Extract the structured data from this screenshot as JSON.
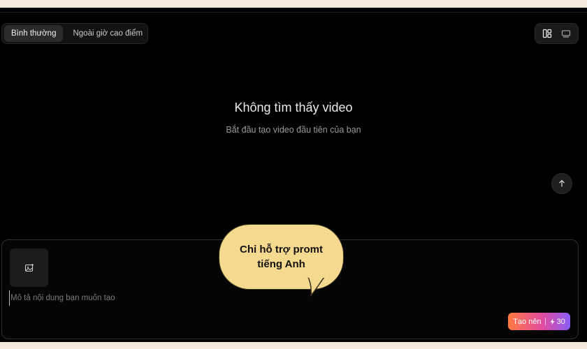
{
  "modes": {
    "normal": "Bình thường",
    "offpeak": "Ngoài giờ cao điểm"
  },
  "empty_state": {
    "title": "Không tìm thấy video",
    "subtitle": "Bắt đầu tạo video đầu tiên của bạn"
  },
  "composer": {
    "placeholder": "Mô tả nội dung bạn muốn tạo",
    "generate_label": "Tạo nên",
    "credits": "30"
  },
  "callout": {
    "text": "Chỉ hỗ trợ promt tiếng Anh"
  },
  "icons": {
    "layout": "grid-layout-icon",
    "list": "list-view-icon",
    "scroll_top": "arrow-up-icon",
    "upload": "image-upload-icon",
    "credits": "lightning-icon"
  },
  "colors": {
    "background": "#000000",
    "callout": "#f5d98f",
    "gradient_start": "#ff7a3d",
    "gradient_end": "#8a5cf5"
  }
}
